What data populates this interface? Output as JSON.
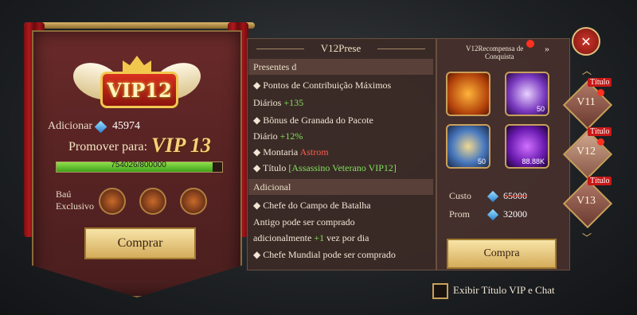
{
  "vip": {
    "badge": "VIP12",
    "add_label": "Adicionar",
    "add_value": "45974",
    "promote_label": "Promover para:",
    "promote_target": "VIP 13",
    "progress_text": "754026/800000",
    "progress_fraction": 0.94,
    "chest_label_line1": "Baú",
    "chest_label_line2": "Exclusivo",
    "buy_label": "Comprar"
  },
  "gift": {
    "title": "V12Prese",
    "section_title": "Presentes d",
    "line1a": "Pontos de Contribuição Máximos",
    "line1b": "Diários",
    "line1b_value": "+135",
    "line2a": "Bônus de Granada do Pacote",
    "line2b": "Diário",
    "line2b_value": "+12%",
    "line3": "Montaria",
    "line3_value": "Astrom",
    "line4": "Título",
    "line4_value": "[Assassino Veterano VIP12]",
    "extra_title": "Adicional",
    "extra1": "Chefe do Campo de Batalha",
    "extra2": "Antigo pode ser comprado",
    "extra3a": "adicionalmente",
    "extra3b": "+1",
    "extra3c": "vez por dia",
    "extra4": "Chefe Mundial pode ser comprado"
  },
  "reward": {
    "label_line1": "V12Recompensa de",
    "label_line2": "Conquista",
    "item2_count": "50",
    "item3_count": "50",
    "item4_count": "88.88K",
    "cost_label": "Custo",
    "cost_value": "65000",
    "prom_label": "Prom",
    "prom_value": "32000",
    "buy_label": "Compra"
  },
  "tiers": [
    {
      "label": "V11",
      "tag": "Título"
    },
    {
      "label": "V12",
      "tag": "Título"
    },
    {
      "label": "V13",
      "tag": "Título"
    }
  ],
  "checkbox_label": "Exibir Título VIP e Chat",
  "icons": {
    "close": "close-icon",
    "gem": "diamond-gem-icon",
    "chest": "treasure-chest-icon",
    "arrow": "double-chevron-right-icon"
  }
}
